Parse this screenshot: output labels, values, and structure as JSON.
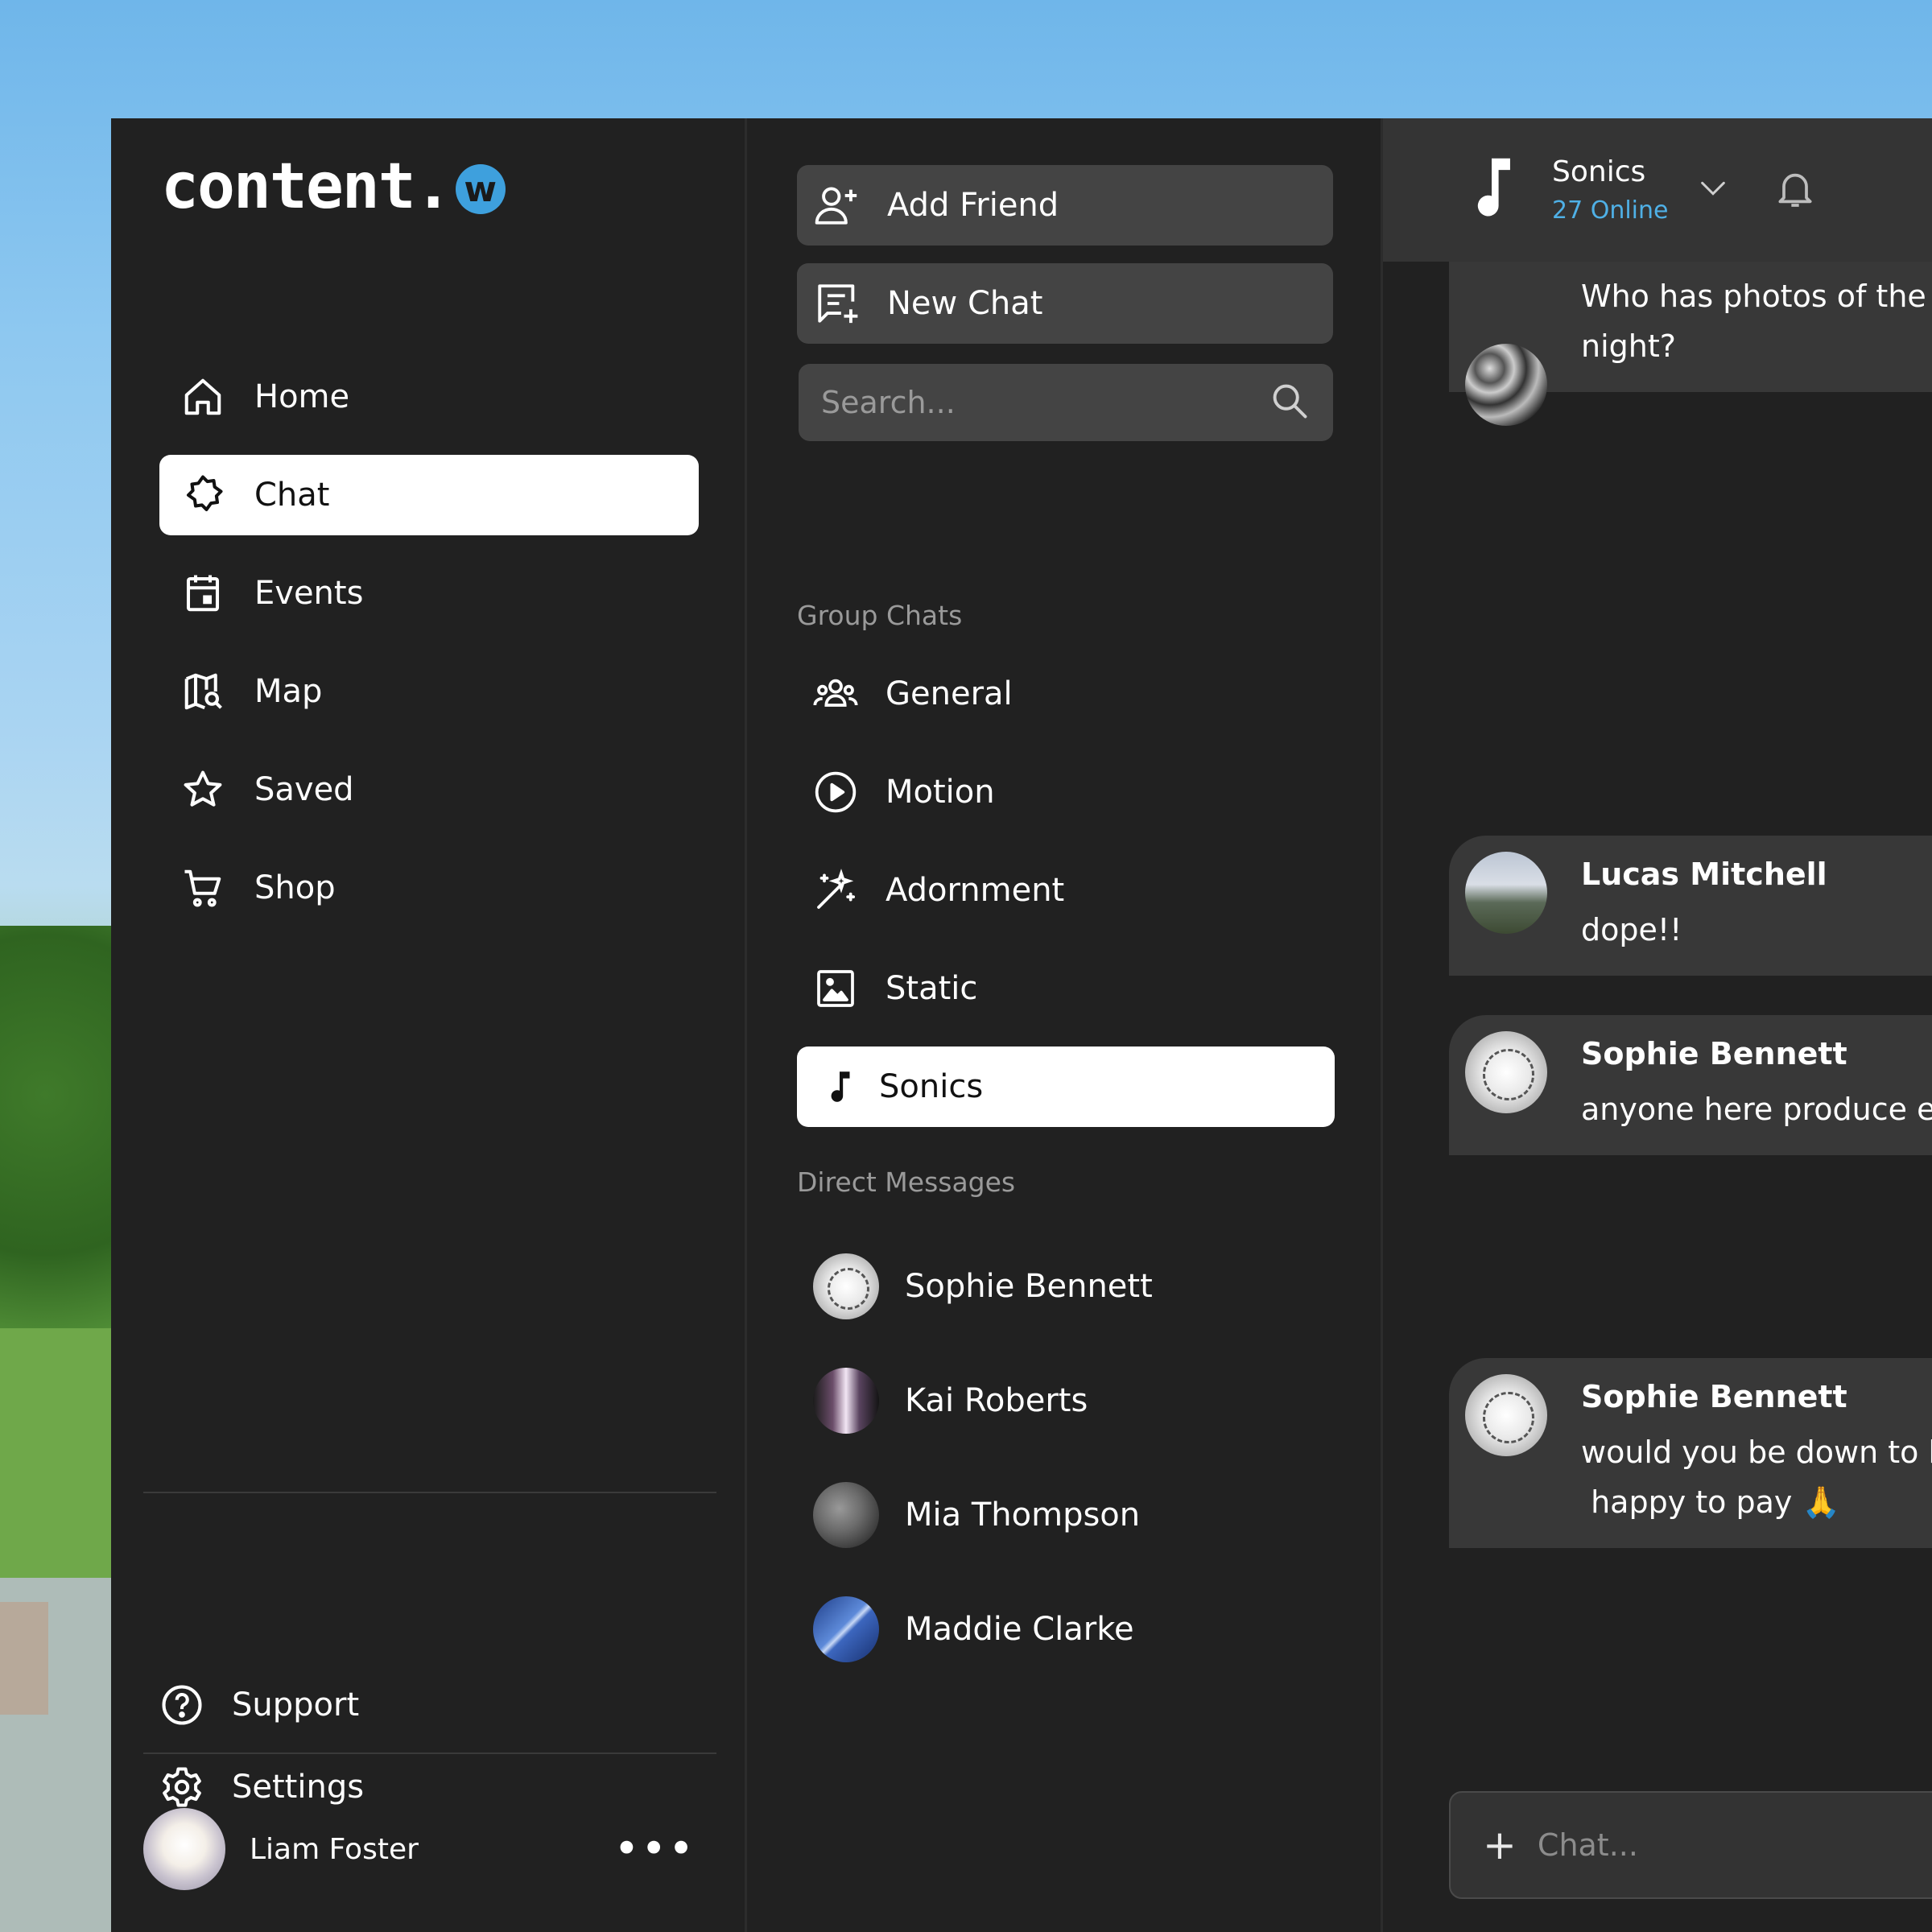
{
  "brand": {
    "name": "content.",
    "badge": "w",
    "accent": "#3ea0dd"
  },
  "sidebar": {
    "items": [
      {
        "label": "Home",
        "icon": "home-icon"
      },
      {
        "label": "Chat",
        "icon": "chat-bubble-icon",
        "active": true
      },
      {
        "label": "Events",
        "icon": "calendar-icon"
      },
      {
        "label": "Map",
        "icon": "map-icon"
      },
      {
        "label": "Saved",
        "icon": "star-icon"
      },
      {
        "label": "Shop",
        "icon": "cart-icon"
      }
    ],
    "bottom": [
      {
        "label": "Support",
        "icon": "help-circle-icon"
      },
      {
        "label": "Settings",
        "icon": "gear-icon"
      }
    ],
    "user": {
      "name": "Liam Foster",
      "more": "•••"
    }
  },
  "middle": {
    "add_friend": "Add Friend",
    "new_chat": "New Chat",
    "search_placeholder": "Search...",
    "group_chats_label": "Group Chats",
    "groups": [
      {
        "label": "General",
        "icon": "group-icon"
      },
      {
        "label": "Motion",
        "icon": "play-circle-icon"
      },
      {
        "label": "Adornment",
        "icon": "magic-wand-icon"
      },
      {
        "label": "Static",
        "icon": "image-icon"
      },
      {
        "label": "Sonics",
        "icon": "music-note-icon",
        "active": true
      }
    ],
    "direct_messages_label": "Direct Messages",
    "dms": [
      {
        "name": "Sophie Bennett"
      },
      {
        "name": "Kai Roberts"
      },
      {
        "name": "Mia Thompson"
      },
      {
        "name": "Maddie Clarke"
      }
    ]
  },
  "chat": {
    "title": "Sonics",
    "online": "27 Online",
    "online_color": "#4fb0e6",
    "messages": [
      {
        "name": "",
        "text": "Who has photos of the h\nnight?"
      },
      {
        "name": "Lucas Mitchell",
        "text": "dope!!"
      },
      {
        "name": "Sophie Bennett",
        "text": "anyone here produce ele"
      },
      {
        "name": "Sophie Bennett",
        "text": "would you be down to he\n happy to pay 🙏"
      }
    ],
    "input_placeholder": "Chat...",
    "add_symbol": "+"
  }
}
